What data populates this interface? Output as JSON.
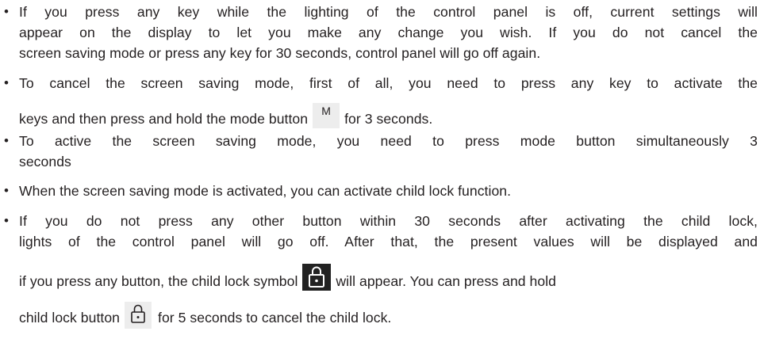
{
  "bullet_char": "•",
  "items": [
    {
      "lines": [
        "If you press any key while the lighting of the control panel is off, current settings will",
        "appear on the display to let you make any change you wish. If you do not cancel the",
        "screen saving mode or press any key for 30 seconds, control panel will go off again."
      ]
    },
    {
      "line1": "To cancel the screen saving mode, first of all, you need to press any key to activate the",
      "line2_before": "keys and then press and hold the mode button",
      "mode_key_label": "M",
      "line2_after": "for 3 seconds."
    },
    {
      "line1": "To active the screen saving mode, you need to press mode button simultaneously 3",
      "line2": "seconds"
    },
    {
      "line1": "When the screen saving mode is activated, you can activate child lock function."
    },
    {
      "line1": "If you do not press any other button within 30 seconds after activating the child lock,",
      "line2": "lights of the control panel will go off. After that, the present values will be displayed and",
      "line3_before": "if you press any button, the child lock symbol",
      "line3_after": "will appear. You can press and hold",
      "line4_before": "child lock button",
      "line4_after": "for 5 seconds to cancel the child lock."
    }
  ],
  "icons": {
    "mode_key": "mode-key-icon",
    "child_lock_symbol": "child-lock-symbol-icon",
    "child_lock_button": "child-lock-button-icon"
  },
  "colors": {
    "text": "#231f20",
    "key_background": "#ededed",
    "lock_symbol_background": "#222222"
  }
}
